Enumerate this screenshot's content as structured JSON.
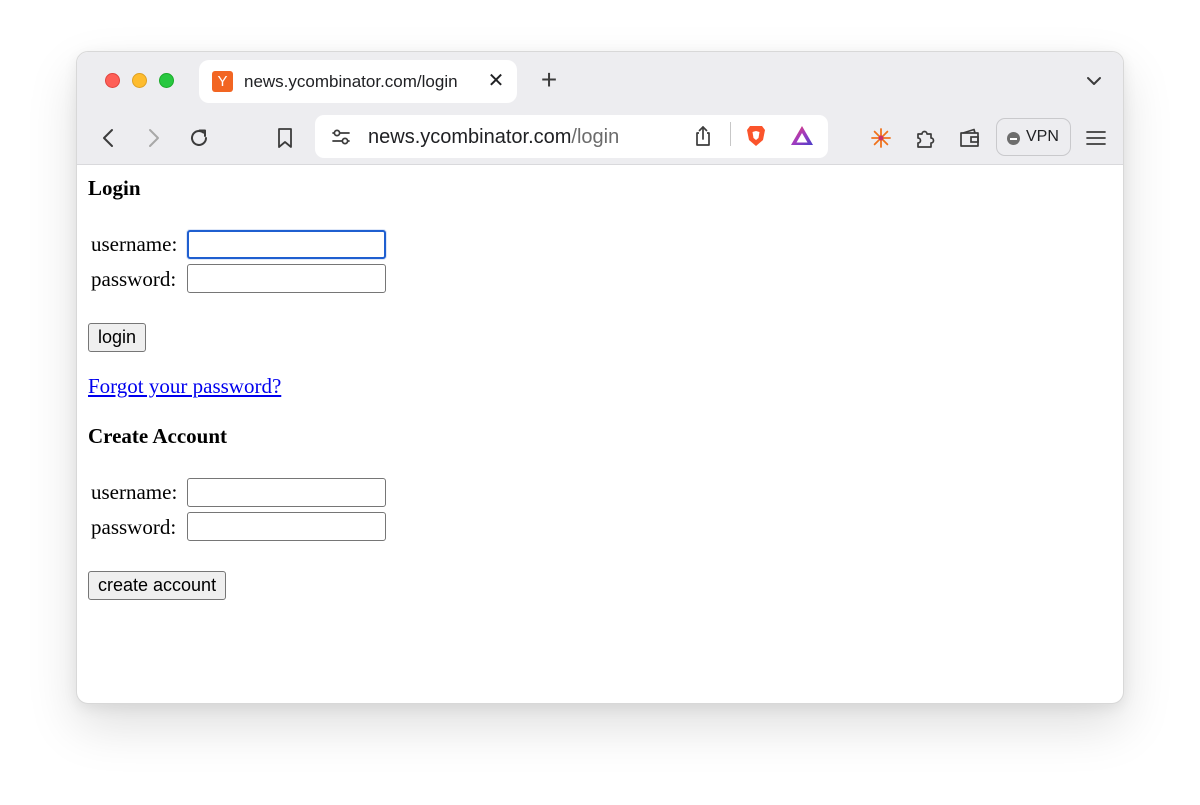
{
  "browser": {
    "tab": {
      "favicon_letter": "Y",
      "title": "news.ycombinator.com/login",
      "close_glyph": "✕"
    },
    "new_tab_glyph": "+",
    "urlbar": {
      "domain": "news.ycombinator.com",
      "path": "/login"
    },
    "vpn_label": "VPN",
    "colors": {
      "favicon_bg": "#f26522",
      "brave_orange": "#fb542b",
      "focus_ring": "#1f5fd0",
      "link": "#0000ee"
    },
    "icons": [
      "back-icon",
      "forward-icon",
      "reload-icon",
      "bookmark-icon",
      "site-settings-icon",
      "share-icon",
      "brave-shields-icon",
      "brave-rewards-icon",
      "leo-ai-icon",
      "extensions-icon",
      "wallet-icon",
      "menu-icon",
      "tab-list-chevron-icon"
    ]
  },
  "page": {
    "login": {
      "heading": "Login",
      "username_label": "username:",
      "password_label": "password:",
      "username_value": "",
      "password_value": "",
      "submit_label": "login"
    },
    "forgot_link": "Forgot your password?",
    "create_account": {
      "heading": "Create Account",
      "username_label": "username:",
      "password_label": "password:",
      "username_value": "",
      "password_value": "",
      "submit_label": "create account"
    }
  }
}
